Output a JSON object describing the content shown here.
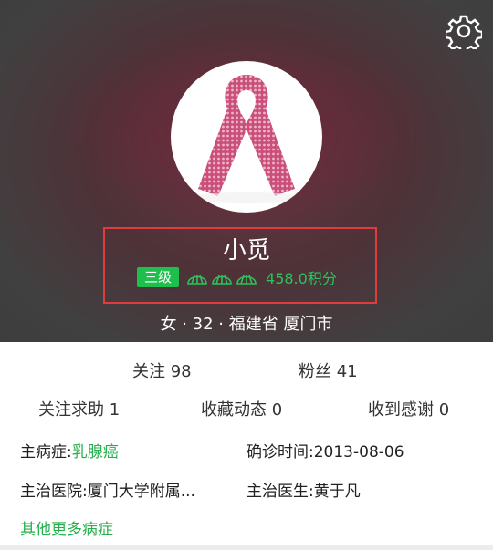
{
  "profile": {
    "name": "小觅",
    "level": "三级",
    "points": "458.0积分",
    "location": "女 · 32 · 福建省 厦门市"
  },
  "icons": {
    "settings": "gear-icon",
    "shell": "shell-icon"
  },
  "stats": {
    "following": "关注 98",
    "fans": "粉丝 41",
    "help": "关注求助 1",
    "favorites": "收藏动态 0",
    "thanks": "收到感谢 0"
  },
  "info": {
    "disease_label": "主病症:",
    "disease_value": "乳腺癌",
    "diagnosis_label": "确诊时间:",
    "diagnosis_value": "2013-08-06",
    "hospital_label": "主治医院:",
    "hospital_value": "厦门大学附属...",
    "doctor_label": "主治医生:",
    "doctor_value": "黄于凡",
    "more": "其他更多病症"
  },
  "colors": {
    "accent_green": "#25b04d",
    "highlight_red": "#e23b3b"
  }
}
